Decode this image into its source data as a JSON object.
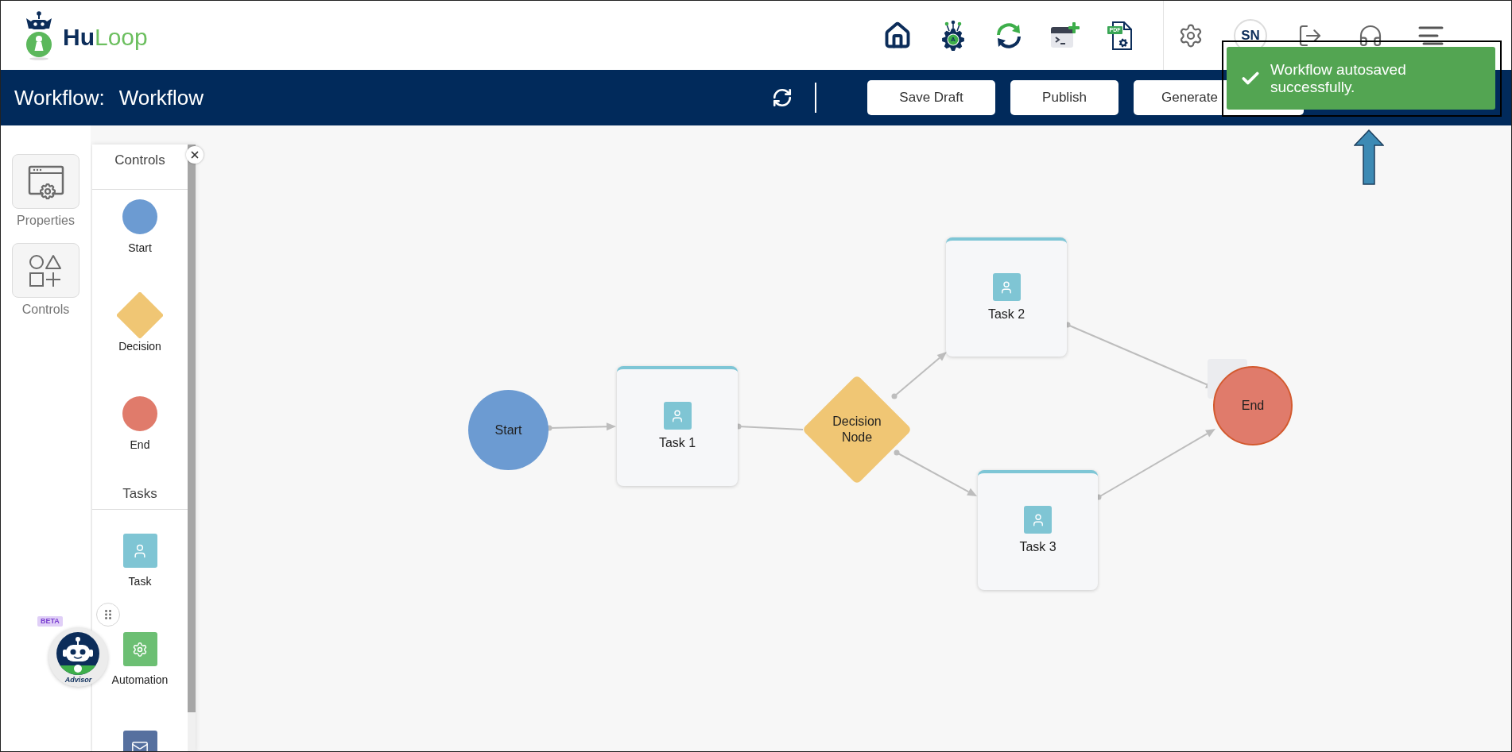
{
  "header": {
    "logo_text": "**Hu**Loop",
    "tools": [
      {
        "kind": "home"
      },
      {
        "kind": "bot",
        "badge": "A"
      },
      {
        "kind": "sync"
      },
      {
        "kind": "terminal"
      },
      {
        "kind": "pdf",
        "badge": "PDF"
      }
    ],
    "actions": [
      {
        "kind": "settings"
      },
      {
        "kind": "avatar",
        "initials": "SN"
      },
      {
        "kind": "logout"
      },
      {
        "kind": "support"
      },
      {
        "kind": "menu"
      }
    ]
  },
  "title_bar": {
    "label": "Workflow:",
    "name": "Workflow",
    "buttons": [
      "Save Draft",
      "Publish",
      "Generate"
    ]
  },
  "toast": {
    "message": "Workflow autosaved successfully."
  },
  "sidebar": {
    "items": [
      {
        "kind": "properties",
        "label": "Properties"
      },
      {
        "kind": "controls",
        "label": "Controls"
      }
    ]
  },
  "controls_panel": {
    "sections": [
      {
        "title": "Controls",
        "items": [
          {
            "kind": "start",
            "label": "Start"
          },
          {
            "kind": "decision",
            "label": "Decision"
          },
          {
            "kind": "end",
            "label": "End"
          }
        ]
      },
      {
        "title": "Tasks",
        "items": [
          {
            "kind": "task",
            "label": "Task"
          },
          {
            "kind": "automation",
            "label": "Automation"
          },
          {
            "kind": "message"
          }
        ]
      }
    ]
  },
  "canvas": {
    "nodes": [
      {
        "kind": "start",
        "label": "Start"
      },
      {
        "kind": "task",
        "label": "Task 1"
      },
      {
        "kind": "decision",
        "label": "Decision Node"
      },
      {
        "kind": "task",
        "label": "Task 2"
      },
      {
        "kind": "task",
        "label": "Task 3"
      },
      {
        "kind": "end",
        "label": "End"
      }
    ]
  },
  "advisor": {
    "badge": "BETA",
    "label": "Advisor"
  }
}
